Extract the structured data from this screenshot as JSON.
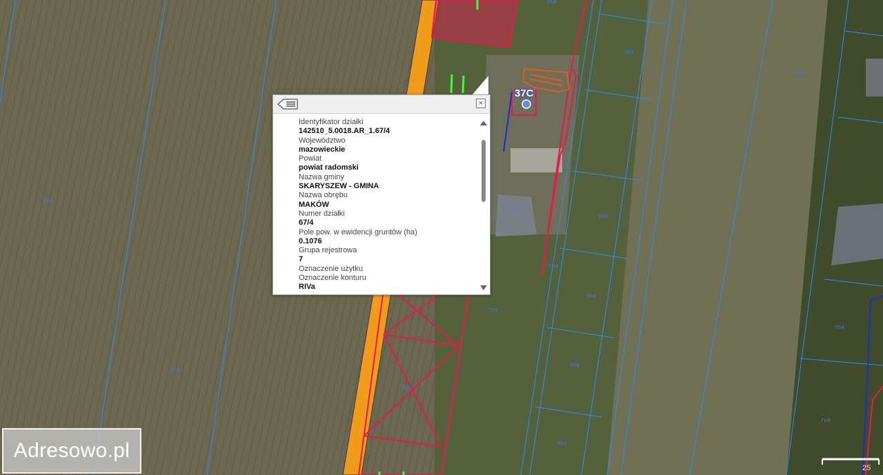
{
  "map": {
    "building_label": "37C",
    "parcel_labels": [
      "67/4",
      "67/4",
      "68/4",
      "68/4",
      "69/4",
      "69/4",
      "69/4",
      "70/4",
      "70/4",
      "71/4",
      "71/4",
      "72/4",
      "72/4",
      "65/4",
      "66/4"
    ],
    "colors": {
      "parcel_lines": "#2b8cff",
      "highlight": "#e8194f",
      "road": "#f19b1b"
    }
  },
  "popup": {
    "attributes": [
      {
        "label": "Identyfikator działki",
        "value": "142510_5.0018.AR_1.67/4"
      },
      {
        "label": "Województwo",
        "value": "mazowieckie"
      },
      {
        "label": "Powiat",
        "value": "powiat radomski"
      },
      {
        "label": "Nazwa gminy",
        "value": "SKARYSZEW - GMINA"
      },
      {
        "label": "Nazwa obrębu",
        "value": "MAKÓW"
      },
      {
        "label": "Numer działki",
        "value": "67/4"
      },
      {
        "label": "Pole pow. w ewidencji gruntów (ha)",
        "value": "0.1076"
      },
      {
        "label": "Grupa rejestrowa",
        "value": "7"
      },
      {
        "label": "Oznaczenie użytku",
        "value": ""
      },
      {
        "label": "Oznaczenie konturu",
        "value": "RIVa"
      }
    ],
    "close_symbol": "×"
  },
  "brand": {
    "text": "Adresowo.pl"
  },
  "scale": {
    "label": "25"
  }
}
